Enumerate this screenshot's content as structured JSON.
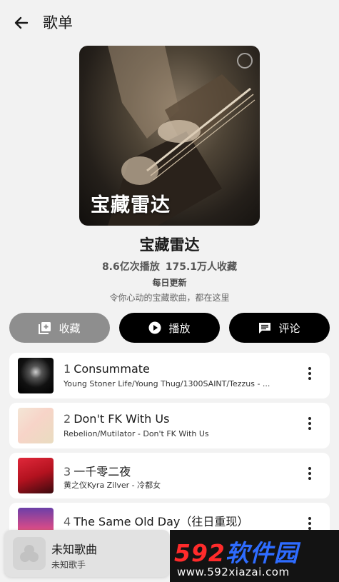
{
  "header": {
    "title": "歌单"
  },
  "cover": {
    "overlay_text": "宝藏雷达"
  },
  "playlist": {
    "title": "宝藏雷达",
    "plays": "8.6亿次播放",
    "favorites": "175.1万人收藏",
    "update": "每日更新",
    "description": "令你心动的宝藏歌曲，都在这里"
  },
  "actions": {
    "favorite": "收藏",
    "play": "播放",
    "comment": "评论"
  },
  "songs": [
    {
      "index": "1",
      "title": "Consummate",
      "subtitle": "Young Stoner Life/Young Thug/1300SAINT/Tezzus - ..."
    },
    {
      "index": "2",
      "title": "Don't FK With Us",
      "subtitle": "Rebelion/Mutilator - Don't FK With Us"
    },
    {
      "index": "3",
      "title": "一千零二夜",
      "subtitle": "黄之仪Kyra Zilver - 冷都女"
    },
    {
      "index": "4",
      "title": "The Same Old Day（往日重现）",
      "subtitle": ""
    }
  ],
  "mini_player": {
    "title": "未知歌曲",
    "artist": "未知歌手"
  },
  "watermark": {
    "logo_num": "592",
    "logo_text": "软件园",
    "url": "www.592xiazai.com"
  },
  "colors": {
    "accent": "#000000",
    "fav_button": "#8e8e8e",
    "background": "#f2f2f2"
  }
}
